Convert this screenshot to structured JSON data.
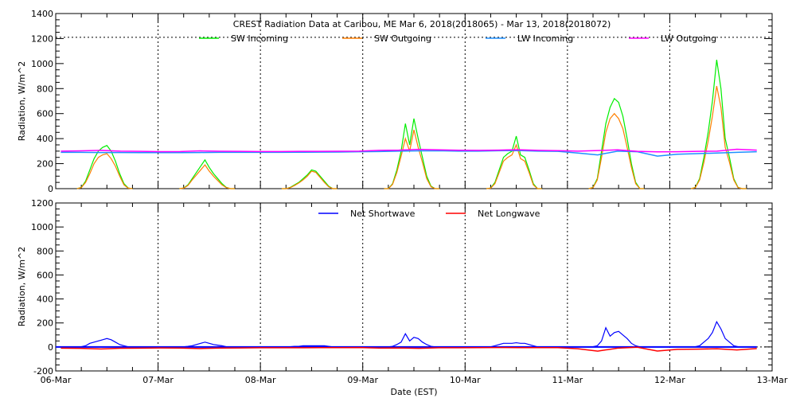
{
  "chart_data": [
    {
      "type": "line",
      "title": "CREST Radiation Data at Caribou, ME   Mar  6, 2018(2018065) - Mar 13, 2018(2018072)",
      "ylabel": "Radiation, W/m^2",
      "ylim": [
        0,
        1400
      ],
      "yticks": [
        "0",
        "200",
        "400",
        "600",
        "800",
        "1000",
        "1200",
        "1400"
      ],
      "legend_position": "top-center",
      "x_unit": "days since 06-Mar 00:00 EST",
      "hourly_day_series_start_hour": 5,
      "series": [
        {
          "name": "SW Incoming",
          "color": "#00ee00",
          "kind": "daytime",
          "days": [
            [
              0,
              10,
              60,
              150,
              240,
              300,
              330,
              345,
              300,
              220,
              120,
              40,
              5,
              0
            ],
            [
              0,
              5,
              30,
              80,
              130,
              180,
              230,
              170,
              120,
              80,
              40,
              10,
              0,
              0
            ],
            [
              0,
              0,
              10,
              30,
              50,
              80,
              110,
              150,
              140,
              100,
              60,
              20,
              0,
              0
            ],
            [
              0,
              0,
              40,
              150,
              300,
              520,
              350,
              560,
              400,
              250,
              100,
              20,
              0,
              0
            ],
            [
              0,
              5,
              50,
              150,
              250,
              280,
              300,
              420,
              270,
              250,
              150,
              40,
              0,
              0
            ],
            [
              0,
              10,
              80,
              300,
              520,
              650,
              720,
              690,
              580,
              400,
              200,
              50,
              0,
              0
            ],
            [
              0,
              10,
              80,
              250,
              450,
              700,
              1030,
              800,
              400,
              250,
              80,
              10,
              0,
              0
            ]
          ]
        },
        {
          "name": "SW Outgoing",
          "color": "#ff7f00",
          "kind": "daytime",
          "days": [
            [
              0,
              8,
              50,
              120,
              200,
              250,
              270,
              280,
              240,
              180,
              100,
              30,
              4,
              0
            ],
            [
              0,
              4,
              25,
              70,
              110,
              150,
              190,
              140,
              100,
              65,
              30,
              8,
              0,
              0
            ],
            [
              0,
              0,
              8,
              25,
              45,
              70,
              100,
              140,
              130,
              90,
              50,
              15,
              0,
              0
            ],
            [
              0,
              0,
              35,
              130,
              260,
              400,
              300,
              470,
              330,
              210,
              80,
              15,
              0,
              0
            ],
            [
              0,
              4,
              40,
              130,
              220,
              250,
              270,
              350,
              240,
              220,
              130,
              30,
              0,
              0
            ],
            [
              0,
              8,
              70,
              250,
              450,
              560,
              600,
              560,
              480,
              330,
              170,
              40,
              0,
              0
            ],
            [
              0,
              8,
              70,
              210,
              380,
              580,
              820,
              650,
              330,
              210,
              70,
              8,
              0,
              0
            ]
          ]
        },
        {
          "name": "LW Incoming",
          "color": "#1e8fff",
          "kind": "sixhourly",
          "values": [
            290,
            290,
            289,
            289,
            288,
            288,
            288,
            289,
            290,
            290,
            290,
            290,
            291,
            292,
            293,
            295,
            297,
            300,
            302,
            303,
            300,
            300,
            303,
            305,
            300,
            298,
            285,
            270,
            300,
            295,
            260,
            275,
            280,
            285,
            290,
            295
          ]
        },
        {
          "name": "LW Outgoing",
          "color": "#ff00ff",
          "kind": "sixhourly",
          "values": [
            300,
            302,
            306,
            300,
            298,
            296,
            297,
            302,
            299,
            298,
            297,
            297,
            298,
            298,
            299,
            300,
            306,
            308,
            314,
            310,
            307,
            306,
            308,
            311,
            306,
            304,
            300,
            305,
            310,
            298,
            294,
            295,
            298,
            300,
            315,
            308
          ]
        }
      ]
    },
    {
      "type": "line",
      "ylabel": "Radiation, W/m^2",
      "xlabel": "Date (EST)",
      "ylim": [
        -200,
        1200
      ],
      "yticks": [
        "-200",
        "0",
        "200",
        "400",
        "600",
        "800",
        "1000",
        "1200"
      ],
      "xticks": [
        "06-Mar",
        "07-Mar",
        "08-Mar",
        "09-Mar",
        "10-Mar",
        "11-Mar",
        "12-Mar",
        "13-Mar"
      ],
      "legend_position": "top-center",
      "series": [
        {
          "name": "Net Shortwave",
          "color": "#0000ff",
          "kind": "daytime",
          "days": [
            [
              0,
              2,
              10,
              30,
              40,
              50,
              60,
              70,
              60,
              40,
              20,
              10,
              1,
              0
            ],
            [
              0,
              1,
              5,
              10,
              20,
              30,
              40,
              30,
              20,
              15,
              10,
              2,
              0,
              0
            ],
            [
              0,
              0,
              2,
              5,
              5,
              10,
              10,
              10,
              10,
              10,
              10,
              5,
              0,
              0
            ],
            [
              0,
              0,
              5,
              20,
              40,
              110,
              50,
              80,
              70,
              40,
              20,
              5,
              0,
              0
            ],
            [
              0,
              1,
              10,
              20,
              30,
              30,
              30,
              35,
              30,
              30,
              20,
              10,
              0,
              0
            ],
            [
              0,
              2,
              10,
              50,
              160,
              90,
              120,
              130,
              100,
              70,
              30,
              10,
              0,
              0
            ],
            [
              0,
              2,
              10,
              40,
              70,
              120,
              210,
              150,
              70,
              40,
              10,
              2,
              0,
              0
            ]
          ]
        },
        {
          "name": "Net Longwave",
          "color": "#ff0000",
          "kind": "sixhourly",
          "values": [
            -10,
            -12,
            -17,
            -11,
            -10,
            -8,
            -9,
            -13,
            -9,
            -8,
            -7,
            -7,
            -7,
            -6,
            -6,
            -5,
            -9,
            -8,
            -12,
            -7,
            -7,
            -6,
            -5,
            -6,
            -6,
            -6,
            -15,
            -35,
            -10,
            -3,
            -34,
            -20,
            -18,
            -15,
            -25,
            -13
          ]
        }
      ]
    }
  ]
}
